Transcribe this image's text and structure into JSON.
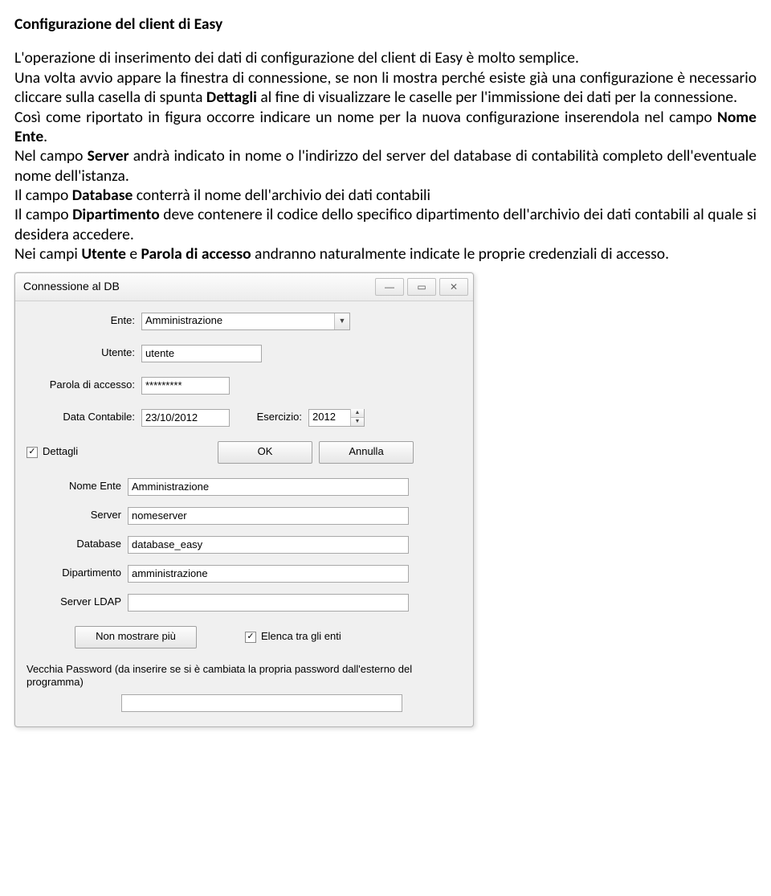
{
  "doc": {
    "title": "Configurazione del client di Easy",
    "p1": "L'operazione di inserimento dei dati di configurazione del client di Easy è molto semplice.",
    "p2a": "Una volta avvio appare la finestra di connessione, se non li mostra perché esiste già una configurazione è necessario cliccare sulla casella di spunta ",
    "p2b": "Dettagli",
    "p2c": " al fine di visualizzare le caselle per l'immissione dei dati per la connessione.",
    "p3a": "Così come riportato in figura occorre indicare un nome per la nuova configurazione inserendola nel campo ",
    "p3b": "Nome Ente",
    "p3c": ".",
    "p4a": "Nel  campo ",
    "p4b": "Server",
    "p4c": " andrà indicato in nome o l'indirizzo del server del database di contabilità completo dell'eventuale nome dell'istanza.",
    "p5a": "Il campo ",
    "p5b": "Database",
    "p5c": " conterrà il nome dell'archivio dei dati contabili",
    "p6a": "Il campo ",
    "p6b": "Dipartimento",
    "p6c": " deve contenere il codice dello specifico dipartimento dell'archivio dei dati contabili al quale si desidera accedere.",
    "p7a": "Nei campi ",
    "p7b": "Utente",
    "p7c": " e ",
    "p7d": "Parola di accesso",
    "p7e": " andranno naturalmente indicate le proprie credenziali di accesso."
  },
  "dialog": {
    "title": "Connessione al DB",
    "labels": {
      "ente": "Ente:",
      "utente": "Utente:",
      "password": "Parola di accesso:",
      "data_contabile": "Data Contabile:",
      "esercizio": "Esercizio:",
      "dettagli": "Dettagli",
      "nome_ente": "Nome Ente",
      "server": "Server",
      "database": "Database",
      "dipartimento": "Dipartimento",
      "server_ldap": "Server LDAP",
      "elenca": "Elenca tra gli enti",
      "old_password": "Vecchia Password (da inserire se si è cambiata la propria password dall'esterno del programma)"
    },
    "values": {
      "ente": "Amministrazione",
      "utente": "utente",
      "password": "*********",
      "data_contabile": "23/10/2012",
      "esercizio": "2012",
      "nome_ente": "Amministrazione",
      "server": "nomeserver",
      "database": "database_easy",
      "dipartimento": "amministrazione",
      "server_ldap": "",
      "old_password": ""
    },
    "buttons": {
      "ok": "OK",
      "cancel": "Annulla",
      "non_mostrare": "Non mostrare più"
    }
  }
}
